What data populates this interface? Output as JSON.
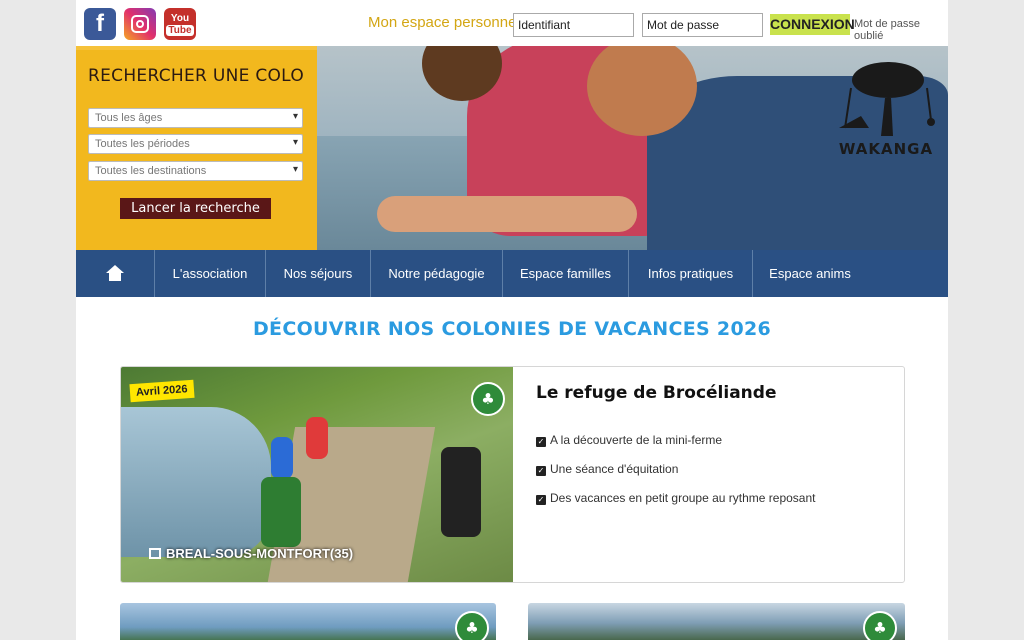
{
  "header": {
    "social": [
      {
        "name": "facebook",
        "label": "f"
      },
      {
        "name": "instagram",
        "label": ""
      },
      {
        "name": "youtube",
        "label_top": "You",
        "label_bottom": "Tube"
      }
    ],
    "account_title": "Mon espace personnel",
    "login_placeholder": "Identifiant",
    "password_placeholder": "Mot de passe",
    "login_button": "CONNEXION",
    "forgot_link": "Mot de passe oublié"
  },
  "search": {
    "title": "RECHERCHER UNE COLO",
    "age_select": "Tous les âges",
    "period_select": "Toutes les périodes",
    "destination_select": "Toutes les destinations",
    "submit_button": "Lancer la recherche"
  },
  "brand": {
    "logo_text": "WAKANGA"
  },
  "nav": {
    "items": [
      {
        "label": "L'association"
      },
      {
        "label": "Nos séjours"
      },
      {
        "label": "Notre pédagogie"
      },
      {
        "label": "Espace familles"
      },
      {
        "label": "Infos pratiques"
      },
      {
        "label": "Espace anims"
      }
    ]
  },
  "main": {
    "section_title": "DÉCOUVRIR NOS COLONIES DE VACANCES 2026",
    "featured": {
      "date_badge": "Avril 2026",
      "location": "BREAL-SOUS-MONTFORT(35)",
      "title": "Le refuge de Brocéliande",
      "features": [
        "A la découverte de la mini-ferme",
        "Une séance d'équitation",
        "Des vacances en petit groupe au rythme reposant"
      ],
      "category_icon": "tree-icon"
    }
  },
  "colors": {
    "nav_bg": "#2a5084",
    "search_bg": "#f2b81e",
    "accent_title": "#2b9be0",
    "login_btn": "#c9e24d",
    "date_badge": "#ffe600",
    "nature_badge": "#2f8b3a"
  }
}
